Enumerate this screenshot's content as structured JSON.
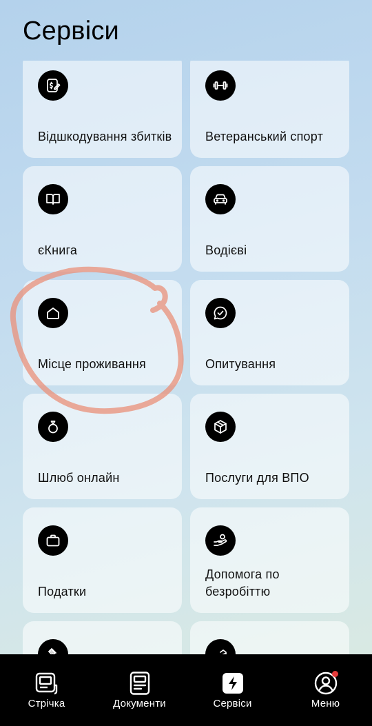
{
  "page": {
    "title": "Сервіси"
  },
  "services": [
    {
      "label": "Відшкодування збитків",
      "icon": "compensation-icon"
    },
    {
      "label": "Ветеранський спорт",
      "icon": "dumbbell-icon"
    },
    {
      "label": "єКнига",
      "icon": "book-icon"
    },
    {
      "label": "Водієві",
      "icon": "car-icon"
    },
    {
      "label": "Місце проживання",
      "icon": "house-icon"
    },
    {
      "label": "Опитування",
      "icon": "chat-check-icon"
    },
    {
      "label": "Шлюб онлайн",
      "icon": "ring-icon"
    },
    {
      "label": "Послуги для ВПО",
      "icon": "box-icon"
    },
    {
      "label": "Податки",
      "icon": "briefcase-icon"
    },
    {
      "label": "Допомога по безробіттю",
      "icon": "hand-coins-icon"
    },
    {
      "label": "",
      "icon": "gavel-icon"
    },
    {
      "label": "",
      "icon": "hand-house-icon"
    }
  ],
  "tabbar": {
    "tabs": [
      {
        "label": "Стрічка",
        "icon": "feed-icon"
      },
      {
        "label": "Документи",
        "icon": "documents-icon"
      },
      {
        "label": "Сервіси",
        "icon": "lightning-icon",
        "active": true
      },
      {
        "label": "Меню",
        "icon": "profile-icon",
        "badge": true
      }
    ]
  },
  "colors": {
    "annotation": "#e9937d",
    "badge": "#e33b3b",
    "tabbar": "#000000"
  }
}
